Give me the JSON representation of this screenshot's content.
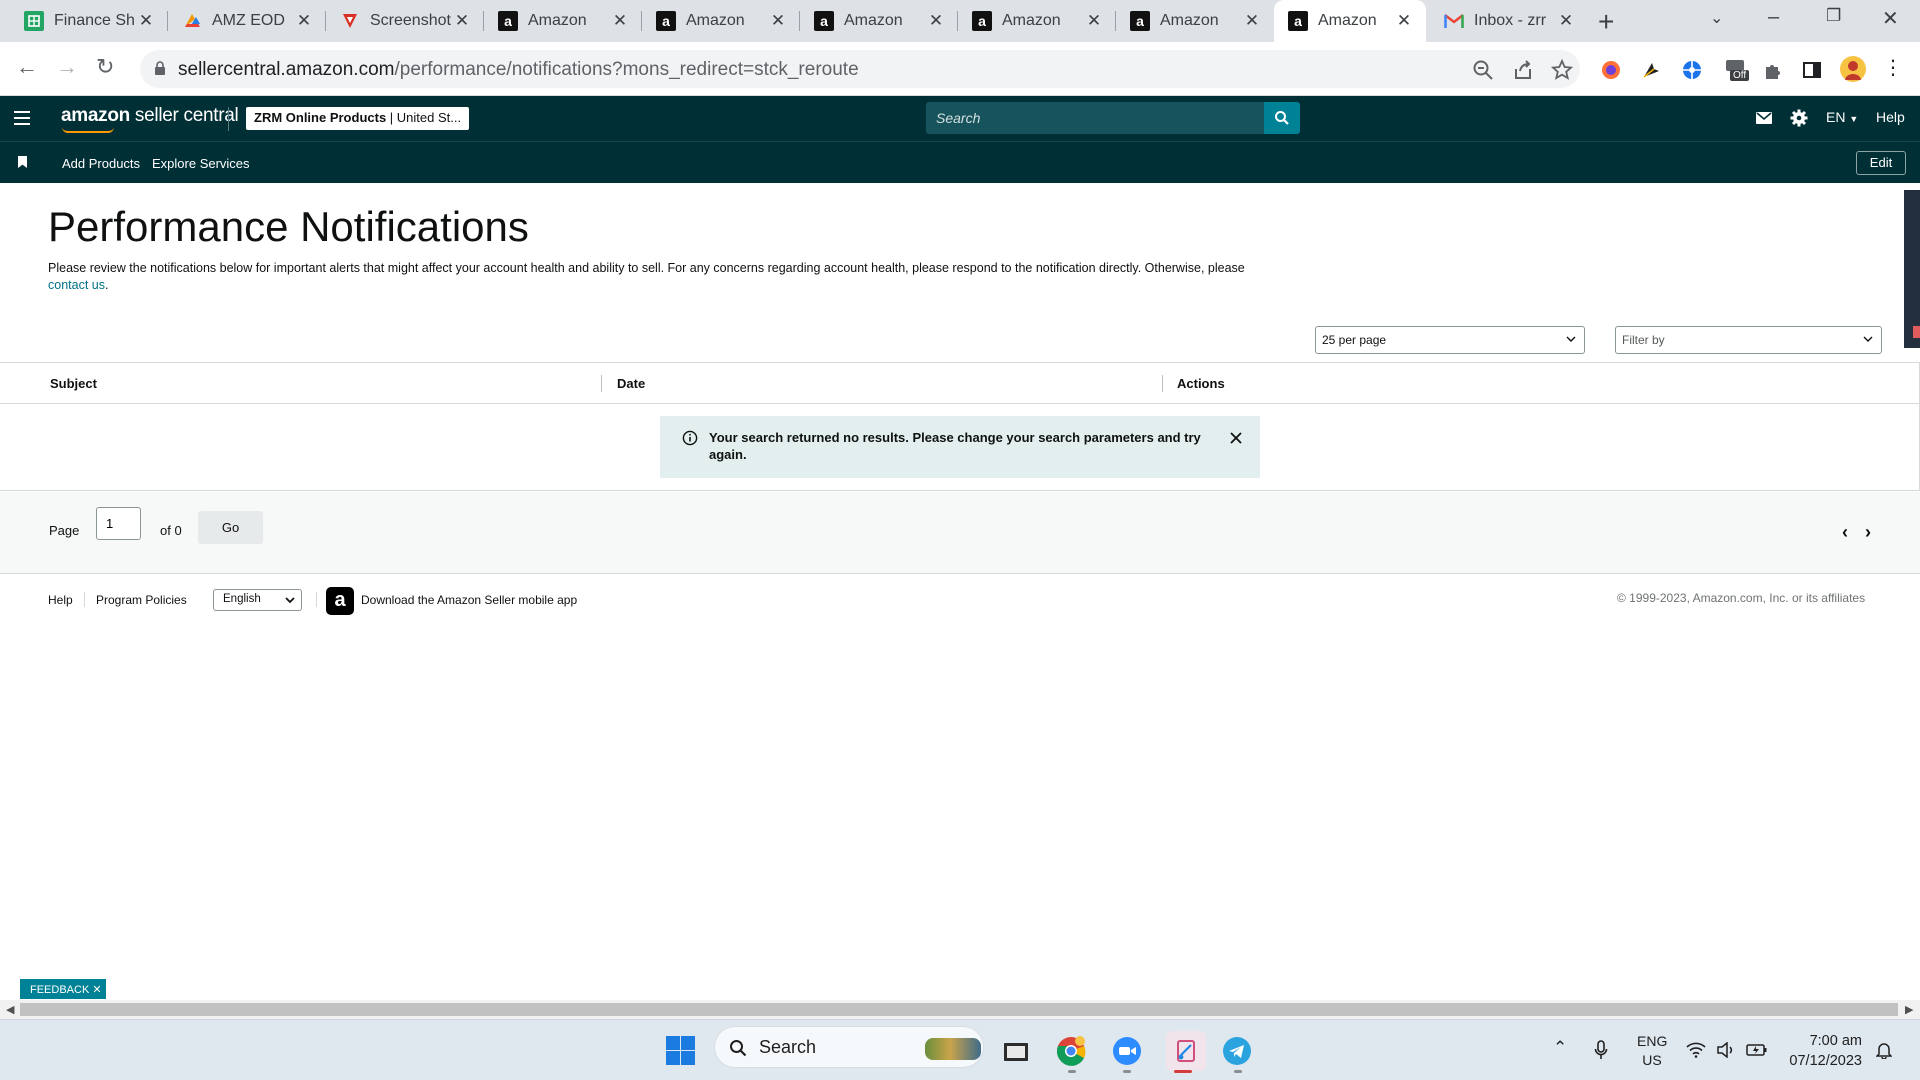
{
  "browser": {
    "tabs": [
      {
        "label": "Finance Sh",
        "icon": "google-sheets-icon"
      },
      {
        "label": "AMZ EOD",
        "icon": "slides-icon"
      },
      {
        "label": "Screenshot",
        "icon": "screenshot-tool-icon"
      },
      {
        "label": "Amazon",
        "icon": "amazon-icon"
      },
      {
        "label": "Amazon",
        "icon": "amazon-icon"
      },
      {
        "label": "Amazon",
        "icon": "amazon-icon"
      },
      {
        "label": "Amazon",
        "icon": "amazon-icon"
      },
      {
        "label": "Amazon",
        "icon": "amazon-icon"
      },
      {
        "label": "Amazon",
        "icon": "amazon-icon",
        "active": true
      },
      {
        "label": "Inbox - zrr",
        "icon": "gmail-icon"
      }
    ],
    "url_domain": "sellercentral.amazon.com",
    "url_path": "/performance/notifications?mons_redirect=stck_reroute",
    "extension_badge": "Off"
  },
  "header": {
    "logo_bold": "amazon",
    "logo_rest": " seller central",
    "account_bold": "ZRM Online Products",
    "account_sep": " | ",
    "account_market": "United St...",
    "search_placeholder": "Search",
    "lang": "EN",
    "help": "Help"
  },
  "subnav": {
    "links": [
      "Add Products",
      "Explore Services"
    ],
    "edit": "Edit"
  },
  "page": {
    "title": "Performance Notifications",
    "intro": "Please review the notifications below for important alerts that might affect your account health and ability to sell. For any concerns regarding account health, please respond to the notification directly. Otherwise, please",
    "contact_link": "contact us",
    "intro_end": ".",
    "per_page": "25 per page",
    "filter_placeholder": "Filter by"
  },
  "table": {
    "columns": [
      "Subject",
      "Date",
      "Actions"
    ],
    "rows": [],
    "alert": "Your search returned no results. Please change your search parameters and try again."
  },
  "pagination": {
    "label": "Page",
    "current": "1",
    "of": "of 0",
    "go": "Go",
    "prev": "‹",
    "next": "›"
  },
  "footer": {
    "help": "Help",
    "policies": "Program Policies",
    "language": "English",
    "app_download": "Download the Amazon Seller mobile app",
    "copyright": "© 1999-2023, Amazon.com, Inc. or its affiliates"
  },
  "feedback": "FEEDBACK ✕",
  "taskbar": {
    "search": "Search",
    "lang_line1": "ENG",
    "lang_line2": "US",
    "time": "7:00 am",
    "date": "07/12/2023"
  },
  "colors": {
    "header_bg": "#002f36",
    "accent_teal": "#008296",
    "link": "#007185",
    "alert_bg": "#e3efef"
  }
}
